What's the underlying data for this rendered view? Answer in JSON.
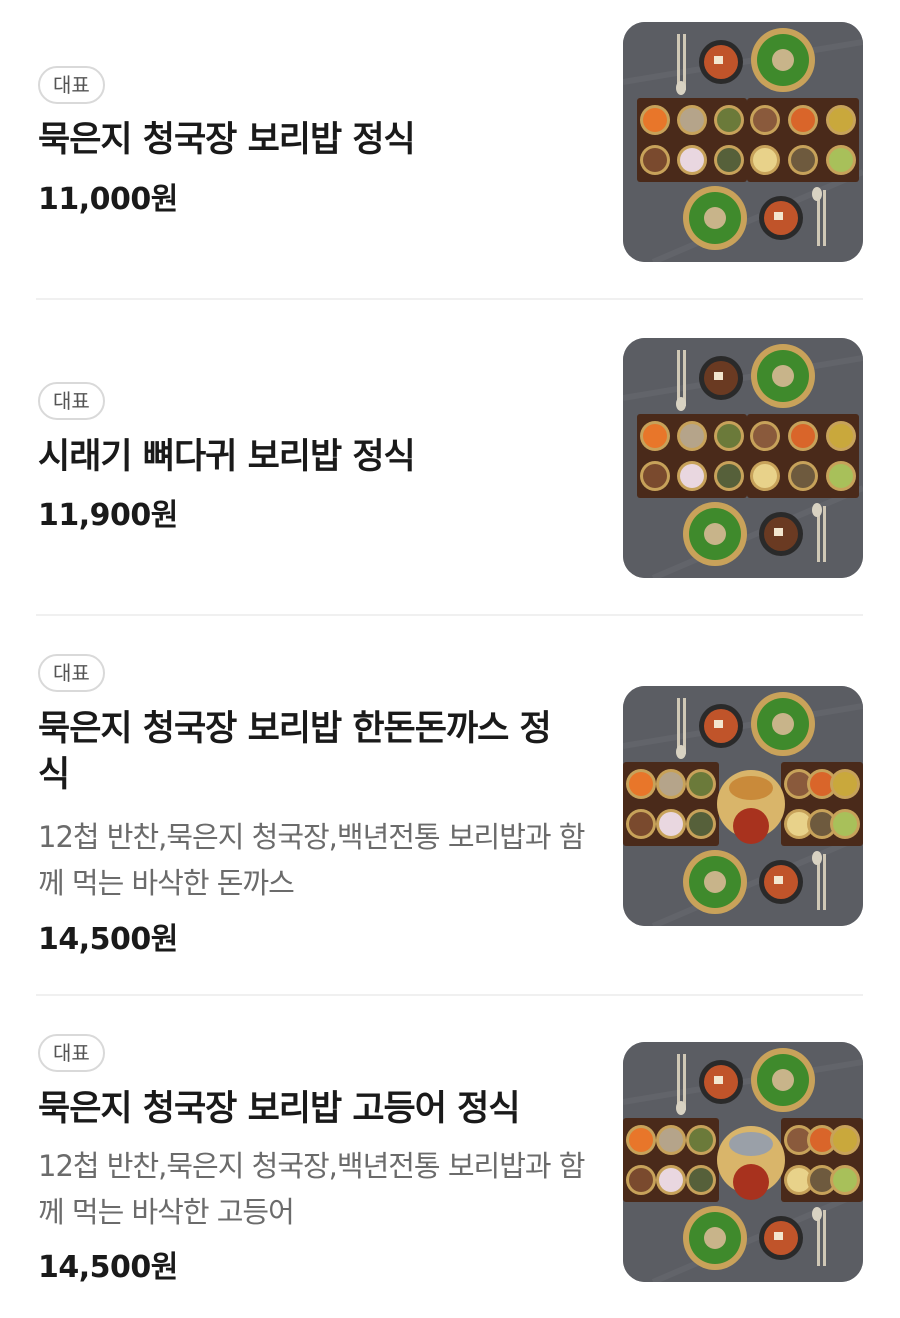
{
  "currency_suffix": "원",
  "menu": [
    {
      "badge": "대표",
      "name": "묵은지 청국장 보리밥 정식",
      "description": "",
      "price": "11,000원",
      "image": "korean-set-meal-photo"
    },
    {
      "badge": "대표",
      "name": "시래기 뼈다귀 보리밥 정식",
      "description": "",
      "price": "11,900원",
      "image": "korean-set-meal-photo"
    },
    {
      "badge": "대표",
      "name": "묵은지 청국장 보리밥 한돈돈까스 정식",
      "description": "12첩 반찬,묵은지 청국장,백년전통 보리밥과 함께 먹는 바삭한 돈까스",
      "price": "14,500원",
      "image": "korean-set-meal-photo"
    },
    {
      "badge": "대표",
      "name": "묵은지 청국장 보리밥 고등어 정식",
      "description": "12첩 반찬,묵은지 청국장,백년전통 보리밥과 함께 먹는 바삭한 고등어",
      "price": "14,500원",
      "image": "korean-set-meal-photo"
    }
  ]
}
